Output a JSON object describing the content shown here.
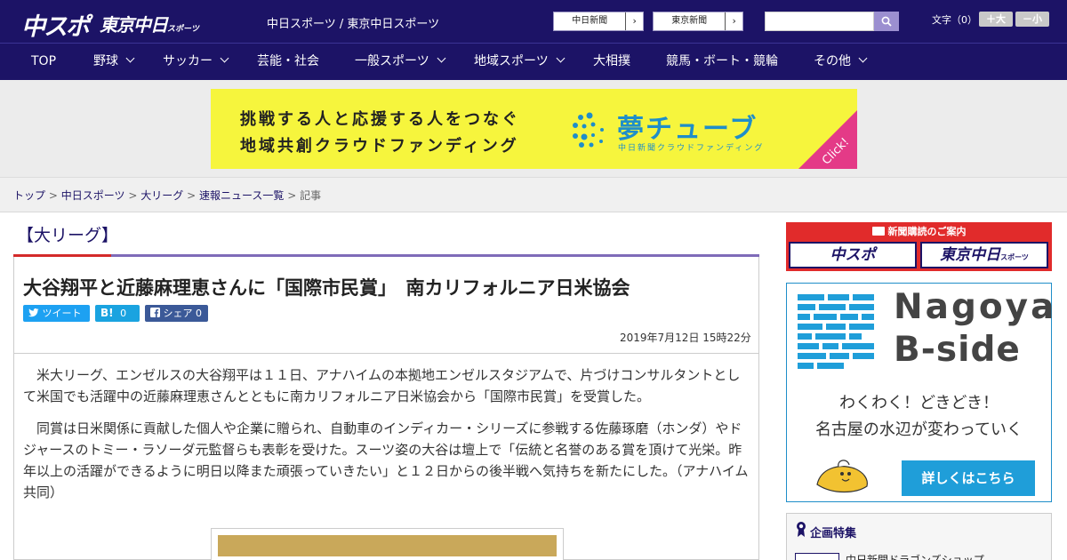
{
  "header": {
    "logo_main": "中スポ",
    "logo_tokyo": "東京中日",
    "logo_tokyo_small": "スポーツ",
    "site_link": "中日スポーツ / 東京中日スポーツ",
    "paper_buttons": [
      {
        "label": "中日新聞",
        "arrow": "›"
      },
      {
        "label": "東京新聞",
        "arrow": "›"
      }
    ],
    "search_placeholder": "",
    "font_size_label": "文字（0）",
    "font_plus": "＋大",
    "font_minus": "－小"
  },
  "nav": {
    "items": [
      {
        "label": "TOP",
        "has_menu": false
      },
      {
        "label": "野球",
        "has_menu": true
      },
      {
        "label": "サッカー",
        "has_menu": true
      },
      {
        "label": "芸能・社会",
        "has_menu": false
      },
      {
        "label": "一般スポーツ",
        "has_menu": true
      },
      {
        "label": "地域スポーツ",
        "has_menu": true
      },
      {
        "label": "大相撲",
        "has_menu": false
      },
      {
        "label": "競馬・ボート・競輪",
        "has_menu": false
      },
      {
        "label": "その他",
        "has_menu": true
      }
    ]
  },
  "banner": {
    "line1": "挑戦する人と応援する人をつなぐ",
    "line2": "地域共創クラウドファンディング",
    "brand": "夢チューブ",
    "sub": "中日新聞クラウドファンディング",
    "click": "Click!",
    "colors": {
      "bg": "#f6f53d",
      "brand": "#1f8ec9",
      "corner": "#e43a87"
    }
  },
  "breadcrumb": {
    "items": [
      "トップ",
      "中日スポーツ",
      "大リーグ",
      "速報ニュース一覧"
    ],
    "separator": ">",
    "current": "記事"
  },
  "article": {
    "category": "【大リーグ】",
    "title": "大谷翔平と近藤麻理恵さんに「国際市民賞」　南カリフォルニア日米協会",
    "share": {
      "tweet": "ツイート",
      "hatena": "B!",
      "hatena_count": "0",
      "facebook": "シェア",
      "facebook_count": "0"
    },
    "date": "2019年7月12日 15時22分",
    "paragraphs": [
      "米大リーグ、エンゼルスの大谷翔平は１１日、アナハイムの本拠地エンゼルスタジアムで、片づけコンサルタントとして米国でも活躍中の近藤麻理恵さんとともに南カリフォルニア日米協会から「国際市民賞」を受賞した。",
      "同賞は日米関係に貢献した個人や企業に贈られ、自動車のインディカー・シリーズに参戦する佐藤琢磨（ホンダ）やドジャースのトミー・ラソーダ元監督らも表彰を受けた。スーツ姿の大谷は壇上で「伝統と名誉のある賞を頂けて光栄。昨年以上の活躍ができるように明日以降また頑張っていきたい」と１２日からの後半戦へ気持ちを新たにした。（アナハイム共同）"
    ]
  },
  "sidebar": {
    "subscribe_title": "新聞購読のご案内",
    "subscribe_logos": [
      "中スポ",
      "東京中日"
    ],
    "subscribe_logo_small": "スポーツ",
    "ad": {
      "city_line1": "Nagoya",
      "city_line2": "B-side",
      "tagline1": "わくわく！どきどき！",
      "tagline2": "名古屋の水辺が変わっていく",
      "cta": "詳しくはこちら"
    },
    "feature_title": "企画特集",
    "feature_item": "中日新聞ドラゴンズショップ"
  },
  "colors": {
    "header_bg": "#1c1366",
    "accent_red": "#d42a2a",
    "accent_purple": "#7f6bb8",
    "tweet": "#1da1f2",
    "hatena": "#1aa3e0",
    "facebook": "#3b5998"
  }
}
